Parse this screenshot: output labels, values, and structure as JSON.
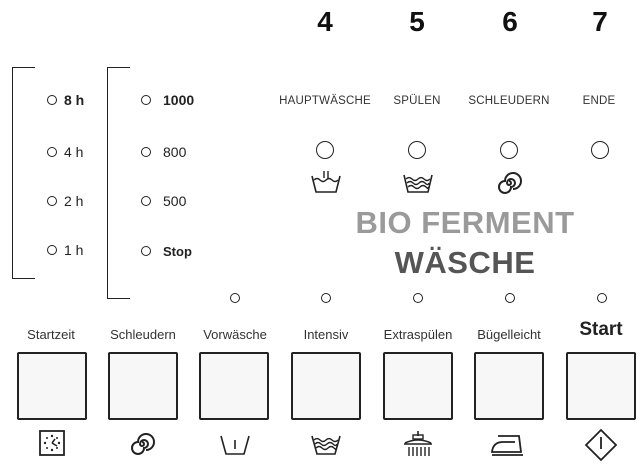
{
  "phases": {
    "numbers": [
      "4",
      "5",
      "6",
      "7"
    ],
    "labels": [
      "HAUPTWÄSCHE",
      "SPÜLEN",
      "SCHLEUDERN",
      "ENDE"
    ]
  },
  "delay": {
    "options": [
      "8 h",
      "4 h",
      "2 h",
      "1 h"
    ],
    "selected": "8 h"
  },
  "spin": {
    "options": [
      "1000",
      "800",
      "500",
      "Stop"
    ],
    "selected": "1000"
  },
  "program": {
    "line1": "BIO FERMENT",
    "line2": "WÄSCHE"
  },
  "buttons": [
    "Startzeit",
    "Schleudern",
    "Vorwäsche",
    "Intensiv",
    "Extraspülen",
    "Bügelleicht",
    "Start"
  ],
  "icons": [
    "clock-icon",
    "spin-spiral-icon",
    "prewash-tub-icon",
    "intensive-wash-icon",
    "extra-rinse-icon",
    "iron-icon",
    "start-diamond-icon"
  ]
}
